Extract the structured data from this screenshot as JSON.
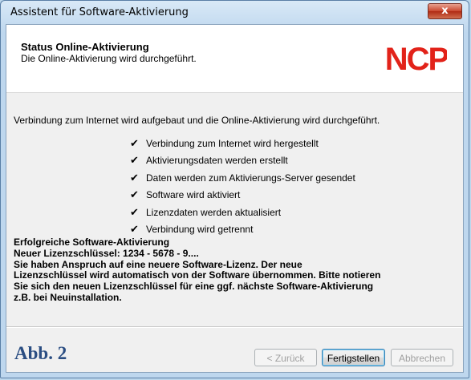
{
  "window": {
    "title": "Assistent für Software-Aktivierung",
    "close_label": "x"
  },
  "header": {
    "title": "Status Online-Aktivierung",
    "subtitle": "Die Online-Aktivierung wird durchgeführt.",
    "logo_text": "NCP",
    "logo_color": "#e2231a"
  },
  "content": {
    "intro": "Verbindung zum Internet wird aufgebaut und die Online-Aktivierung wird durchgeführt.",
    "checks": [
      {
        "mark": "✔",
        "label": "Verbindung zum Internet wird hergestellt"
      },
      {
        "mark": "✔",
        "label": "Aktivierungsdaten werden erstellt"
      },
      {
        "mark": "✔",
        "label": "Daten werden zum Aktivierungs-Server gesendet"
      },
      {
        "mark": "✔",
        "label": "Software wird aktiviert"
      },
      {
        "mark": "✔",
        "label": "Lizenzdaten werden aktualisiert"
      },
      {
        "mark": "✔",
        "label": "Verbindung wird getrennt"
      }
    ],
    "result_lines": [
      "Erfolgreiche Software-Aktivierung",
      "Neuer Lizenzschlüssel: 1234 - 5678 - 9....",
      "Sie haben Anspruch auf eine neuere Software-Lizenz. Der neue",
      "Lizenzschlüssel wird automatisch von der Software übernommen. Bitte notieren",
      "Sie sich den neuen Lizenzschlüssel für eine ggf. nächste Software-Aktivierung",
      "z.B. bei Neuinstallation."
    ]
  },
  "footer": {
    "caption": "Abb. 2",
    "back_label": "< Zurück",
    "finish_label": "Fertigstellen",
    "cancel_label": "Abbrechen"
  }
}
